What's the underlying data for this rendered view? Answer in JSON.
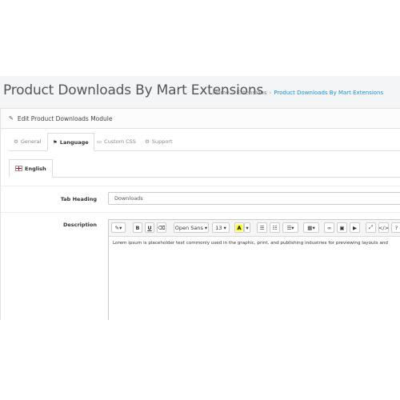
{
  "header": {
    "title": "Product Downloads By Mart Extensions",
    "breadcrumb": [
      "Home",
      "Extensions",
      "Product Downloads By Mart Extensions"
    ]
  },
  "panel": {
    "heading": "Edit Product Downloads Module",
    "tabs": [
      "General",
      "Language",
      "Custom CSS",
      "Support"
    ],
    "active_tab": "Language",
    "language_tab": "English"
  },
  "form": {
    "tab_heading_label": "Tab Heading",
    "tab_heading_value": "Downloads",
    "description_label": "Description",
    "description_text": "Lorem ipsum is placeholder text commonly used in the graphic, print, and publishing industries for previewing layouts and"
  },
  "toolbar": {
    "font_family": "Open Sans",
    "font_size": "13",
    "highlight_letter": "A"
  },
  "colors": {
    "accent": "#1e91cf",
    "background": "#f4f5f6"
  }
}
